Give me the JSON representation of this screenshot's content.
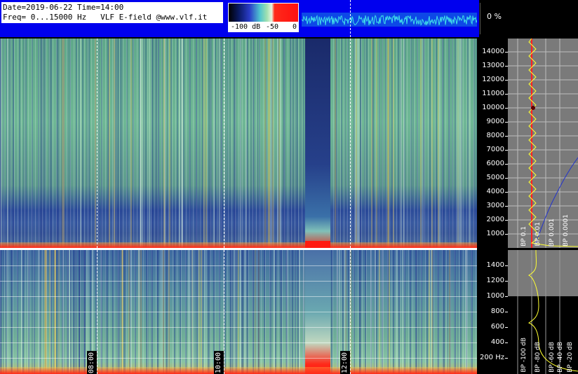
{
  "header": {
    "info_line1": "Date=2019-06-22 Time=14:00",
    "info_line2": "Freq= 0...15000 Hz   VLF E-field @www.vlf.it",
    "scale_labels": [
      "-100 dB",
      "-50",
      "0"
    ],
    "percent": "0 %"
  },
  "axis_top": {
    "labels": [
      "14000",
      "13000",
      "12000",
      "11000",
      "10000",
      "9000",
      "8000",
      "7000",
      "6000",
      "5000",
      "4000",
      "3000",
      "2000",
      "1000"
    ]
  },
  "axis_bottom": {
    "labels": [
      "1400",
      "1200",
      "1000",
      "800",
      "600",
      "400",
      "200 Hz"
    ]
  },
  "time_labels": [
    "08:00",
    "10:00",
    "12:00"
  ],
  "side_panels": {
    "bp_labels": [
      "BP 0.1",
      "BP 0.01",
      "BP 0.001",
      "BP 0.0001"
    ],
    "bp_labels_bottom": [
      "BP -100 dB",
      "BP -80 dB",
      "BP -60 dB",
      "BP -40 dB",
      "BP -20 dB"
    ]
  },
  "colors": {
    "header_blue": "#0000ee",
    "axis_bg": "#000000",
    "side_bg": "#7a7a7a",
    "trace_yellow": "#ffff33",
    "trace_blue": "#2233cc",
    "trace_red": "#ff2020"
  }
}
